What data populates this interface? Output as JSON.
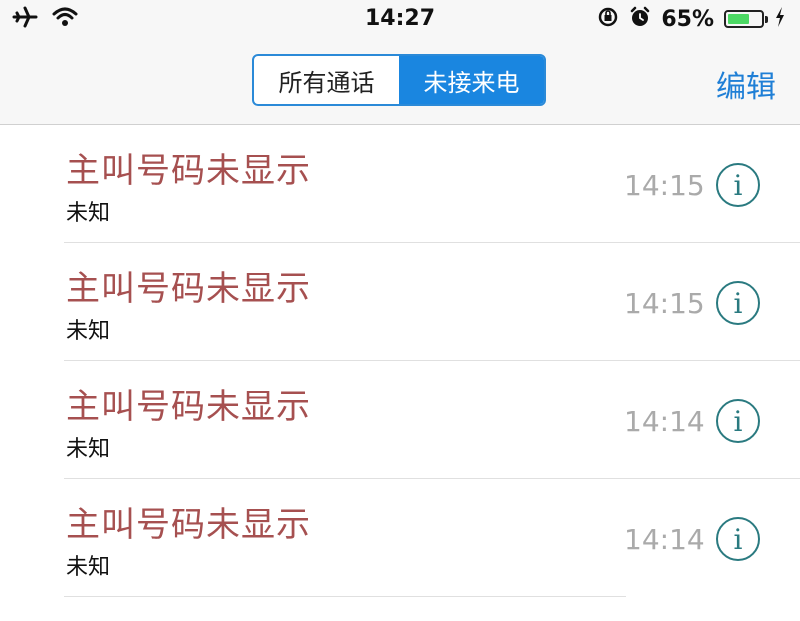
{
  "status_bar": {
    "time": "14:27",
    "battery_percent": "65%",
    "battery_level": 0.65,
    "icons": [
      "airplane-icon",
      "wifi-icon",
      "rotation-lock-icon",
      "alarm-icon",
      "battery-icon",
      "charging-icon"
    ]
  },
  "nav": {
    "segments": [
      {
        "label": "所有通话",
        "selected": false
      },
      {
        "label": "未接来电",
        "selected": true
      }
    ],
    "edit_label": "编辑"
  },
  "calls": [
    {
      "caller": "主叫号码未显示",
      "type": "未知",
      "time": "14:15"
    },
    {
      "caller": "主叫号码未显示",
      "type": "未知",
      "time": "14:15"
    },
    {
      "caller": "主叫号码未显示",
      "type": "未知",
      "time": "14:14"
    },
    {
      "caller": "主叫号码未显示",
      "type": "未知",
      "time": "14:14"
    }
  ],
  "colors": {
    "accent": "#1a86e0",
    "missed_call_text": "#a65050",
    "time_text": "#aaaaaa",
    "info_icon": "#2a7a80",
    "battery_fill": "#4cd964"
  }
}
